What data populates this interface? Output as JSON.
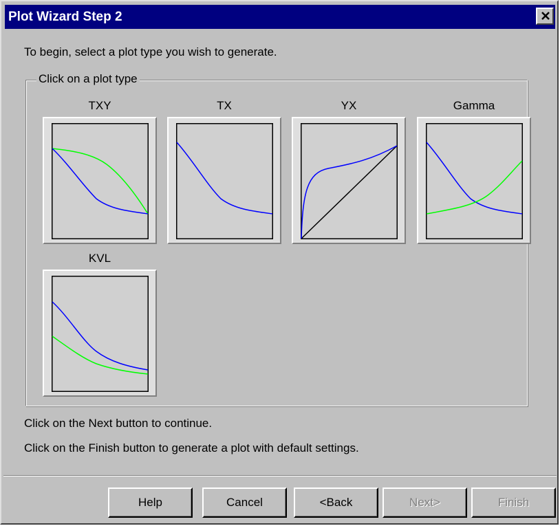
{
  "window": {
    "title": "Plot Wizard Step 2"
  },
  "intro_text": "To begin, select a plot type you wish to generate.",
  "group": {
    "legend": "Click on a plot type"
  },
  "plot_types": [
    {
      "label": "TXY",
      "icon": "txy-plot-icon"
    },
    {
      "label": "TX",
      "icon": "tx-plot-icon"
    },
    {
      "label": "YX",
      "icon": "yx-plot-icon"
    },
    {
      "label": "Gamma",
      "icon": "gamma-plot-icon"
    },
    {
      "label": "KVL",
      "icon": "kvl-plot-icon"
    }
  ],
  "messages": {
    "next_hint": "Click on the Next button to continue.",
    "finish_hint": "Click on the Finish button to generate a plot with default settings."
  },
  "buttons": {
    "help": "Help",
    "cancel": "Cancel",
    "back": "<Back",
    "next": "Next>",
    "finish": "Finish"
  },
  "colors": {
    "title_bar": "#000080",
    "face": "#c0c0c0",
    "curve_blue": "#0000ff",
    "curve_green": "#00ff00"
  }
}
